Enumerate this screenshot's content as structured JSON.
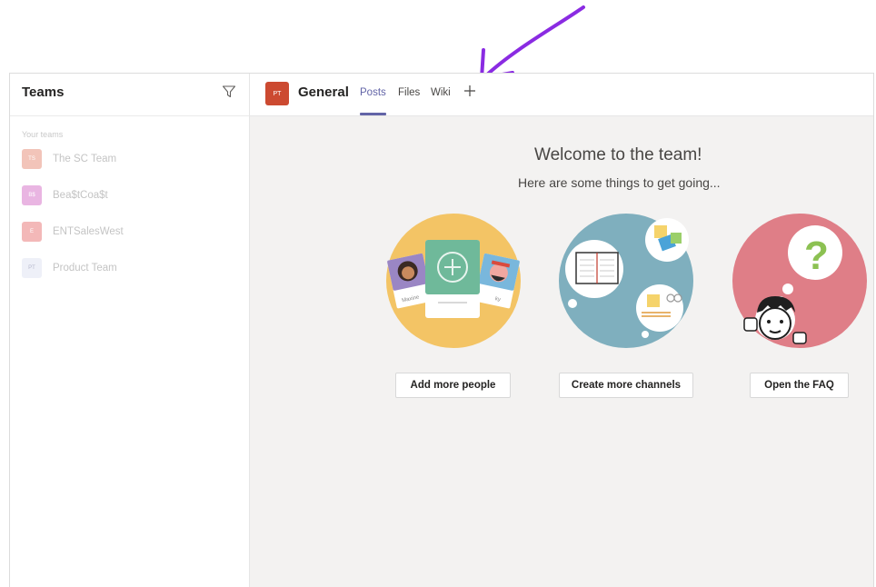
{
  "sidebar": {
    "title": "Teams",
    "section_label": "Your teams",
    "teams": [
      {
        "initials": "TS",
        "name": "The SC Team",
        "color": "#f2c4b9"
      },
      {
        "initials": "B$",
        "name": "Bea$tCoa$t",
        "color": "#e9b5e2"
      },
      {
        "initials": "E",
        "name": "ENTSalesWest",
        "color": "#f3b8b8"
      },
      {
        "initials": "PT",
        "name": "Product Team",
        "color": "#eef0f8"
      }
    ]
  },
  "channel": {
    "initials": "PT",
    "name": "General",
    "tabs": [
      {
        "label": "Posts",
        "active": true
      },
      {
        "label": "Files",
        "active": false
      },
      {
        "label": "Wiki",
        "active": false
      }
    ]
  },
  "main": {
    "welcome_title": "Welcome to the team!",
    "welcome_subtitle": "Here are some things to get going...",
    "cards": [
      {
        "icon": "add-people-illustration",
        "button": "Add more people"
      },
      {
        "icon": "channels-illustration",
        "button": "Create more channels"
      },
      {
        "icon": "faq-illustration",
        "button": "Open the FAQ"
      }
    ]
  },
  "card_labels": {
    "left_person": "Maxine",
    "right_person": "ky"
  },
  "colors": {
    "accent": "#6264a7",
    "channel_avatar": "#cc4a31",
    "annotation_arrow": "#8a2be2"
  }
}
